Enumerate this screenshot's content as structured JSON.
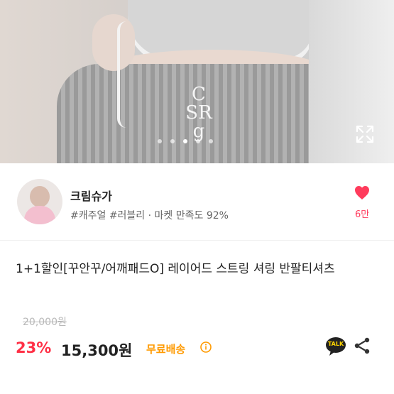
{
  "hero": {
    "logo_text": "CSRg",
    "image_count": 5,
    "active_index": 2
  },
  "seller": {
    "name": "크림슈가",
    "meta": "#캐주얼 #러블리 · 마켓 만족도 92%",
    "like_count": "6만"
  },
  "product": {
    "title": "1+1할인[꾸안꾸/어깨패드O] 레이어드 스트링 셔링 반팔티셔츠",
    "original_price": "20,000원",
    "discount": "23%",
    "price": "15,300원",
    "shipping": "무료배송",
    "talk_label": "TALK"
  },
  "colors": {
    "accent": "#ff2f45",
    "shipping": "#ff9a00",
    "talk_bg": "#222222",
    "talk_text": "#ffd400"
  }
}
